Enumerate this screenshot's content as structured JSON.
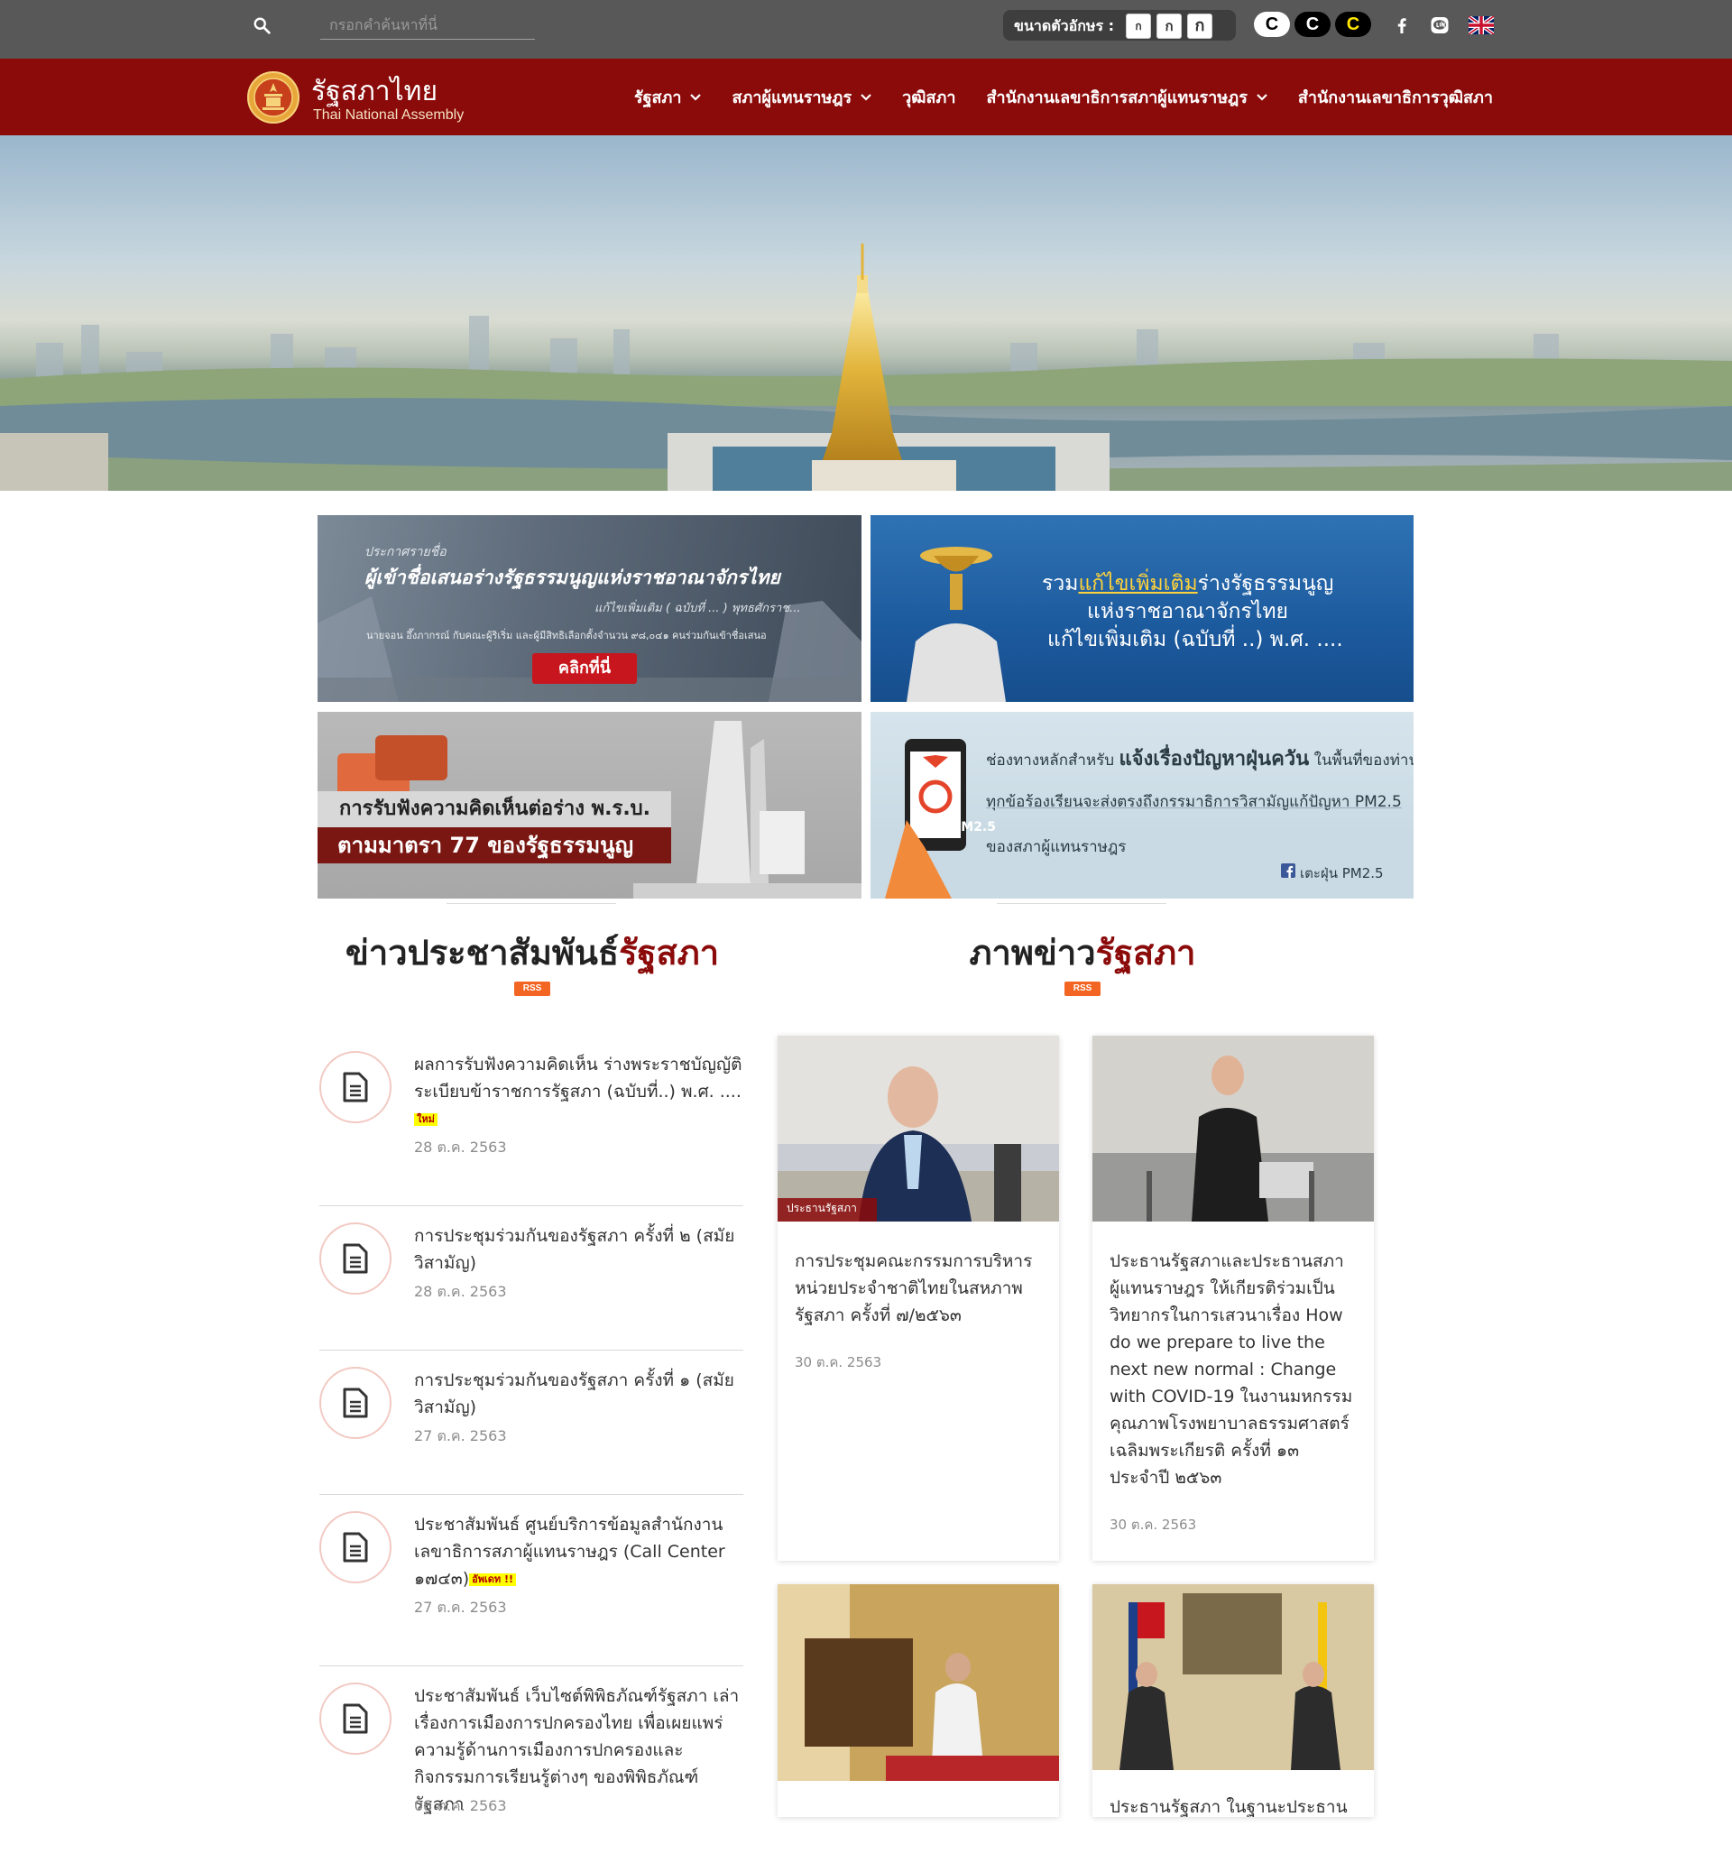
{
  "search": {
    "placeholder": "กรอกคำค้นหาที่นี่"
  },
  "font_size": {
    "label": "ขนาดตัวอักษร :",
    "options": [
      "ก",
      "ก",
      "ก"
    ]
  },
  "contrast": {
    "options": [
      "C",
      "C",
      "C"
    ]
  },
  "logo": {
    "title": "รัฐสภาไทย",
    "subtitle": "Thai National Assembly"
  },
  "nav": {
    "items": [
      {
        "label": "รัฐสภา",
        "dropdown": true
      },
      {
        "label": "สภาผู้แทนราษฎร",
        "dropdown": true
      },
      {
        "label": "วุฒิสภา",
        "dropdown": false
      },
      {
        "label": "สำนักงานเลขาธิการสภาผู้แทนราษฎร",
        "dropdown": true
      },
      {
        "label": "สำนักงานเลขาธิการวุฒิสภา",
        "dropdown": false
      }
    ]
  },
  "banners": {
    "b1": {
      "kicker": "ประกาศรายชื่อ",
      "headline": "ผู้เข้าชื่อเสนอร่างรัฐธรรมนูญแห่งราชอาณาจักรไทย",
      "line2": "แก้ไขเพิ่มเติม ( ฉบับที่ ... ) พุทธศักราช...",
      "line3": "นายจอน อึ๊งภากรณ์ กับคณะผู้ริเริ่ม และผู้มีสิทธิเลือกตั้งจำนวน ๙๘,๐๔๑ คนร่วมกันเข้าชื่อเสนอ",
      "button": "คลิกที่นี่"
    },
    "b2": {
      "line1_a": "รวม",
      "line1_b": "แก้ไขเพิ่มเติม",
      "line1_c": "ร่างรัฐธรรมนูญ",
      "line2": "แห่งราชอาณาจักรไทย",
      "line3": "แก้ไขเพิ่มเติม (ฉบับที่ ..) พ.ศ. ...."
    },
    "b3": {
      "line1": "การรับฟังความคิดเห็นต่อร่าง พ.ร.บ.",
      "line2": "ตามมาตรา 77 ของรัฐธรรมนูญ"
    },
    "b4": {
      "line1_a": "ช่องทางหลักสำหรับ ",
      "line1_b": "แจ้งเรื่องปัญหาฝุ่นควัน",
      "line1_c": " ในพื้นที่ของท่าน",
      "line2": "ทุกข้อร้องเรียนจะส่งตรงถึงกรรมาธิการวิสามัญแก้ปัญหา PM2.5",
      "line3": "ของสภาผู้แทนราษฎร",
      "fb": "เตะฝุ่น PM2.5",
      "phone_label": "PM2.5"
    }
  },
  "news_section": {
    "title_a": "ข่าวประชาสัมพันธ์",
    "title_b": "รัฐสภา",
    "rss": "RSS"
  },
  "photo_section": {
    "title_a": "ภาพข่าว",
    "title_b": "รัฐสภา",
    "rss": "RSS"
  },
  "news": [
    {
      "title": "ผลการรับฟังความคิดเห็น ร่างพระราชบัญญัติระเบียบข้าราชการรัฐสภา (ฉบับที่..) พ.ศ. ....",
      "badge": "ใหม่",
      "date": "28 ต.ค. 2563"
    },
    {
      "title": "การประชุมร่วมกันของรัฐสภา ครั้งที่ ๒ (สมัยวิสามัญ)",
      "badge": "",
      "date": "28 ต.ค. 2563"
    },
    {
      "title": "การประชุมร่วมกันของรัฐสภา ครั้งที่ ๑ (สมัยวิสามัญ)",
      "badge": "",
      "date": "27 ต.ค. 2563"
    },
    {
      "title": "ประชาสัมพันธ์ ศูนย์บริการข้อมูลสำนักงานเลขาธิการสภาผู้แทนราษฎร (Call Center ๑๗๔๓)",
      "badge": "อัพเดท !!",
      "date": "27 ต.ค. 2563"
    },
    {
      "title": "ประชาสัมพันธ์ เว็บไซต์พิพิธภัณฑ์รัฐสภา เล่าเรื่องการเมืองการปกครองไทย เพื่อเผยแพร่ความรู้ด้านการเมืองการปกครองและกิจกรรมการเรียนรู้ต่างๆ ของพิพิธภัณฑ์รัฐสภา",
      "badge": "",
      "date": "08 ต.ค. 2563"
    }
  ],
  "photos": [
    {
      "title": "การประชุมคณะกรรมการบริหารหน่วยประจำชาติไทยในสหภาพรัฐสภา ครั้งที่ ๗/๒๕๖๓",
      "date": "30 ต.ค. 2563",
      "caption": "ประธานรัฐสภา"
    },
    {
      "title": "ประธานรัฐสภาและประธานสภาผู้แทนราษฎร ให้เกียรติร่วมเป็นวิทยากรในการเสวนาเรื่อง How do we prepare to live the next new normal : Change with COVID-19 ในงานมหกรรมคุณภาพโรงพยาบาลธรรมศาสตร์เฉลิมพระเกียรติ ครั้งที่ ๑๓ ประจำปี ๒๕๖๓",
      "date": "30 ต.ค. 2563"
    },
    {
      "title": "",
      "date": ""
    },
    {
      "title": "ประธานรัฐสภา ในฐานะประธาน",
      "date": ""
    }
  ],
  "colors": {
    "topbar": "#585858",
    "brand": "#8b0a0a",
    "rss": "#f26522"
  }
}
